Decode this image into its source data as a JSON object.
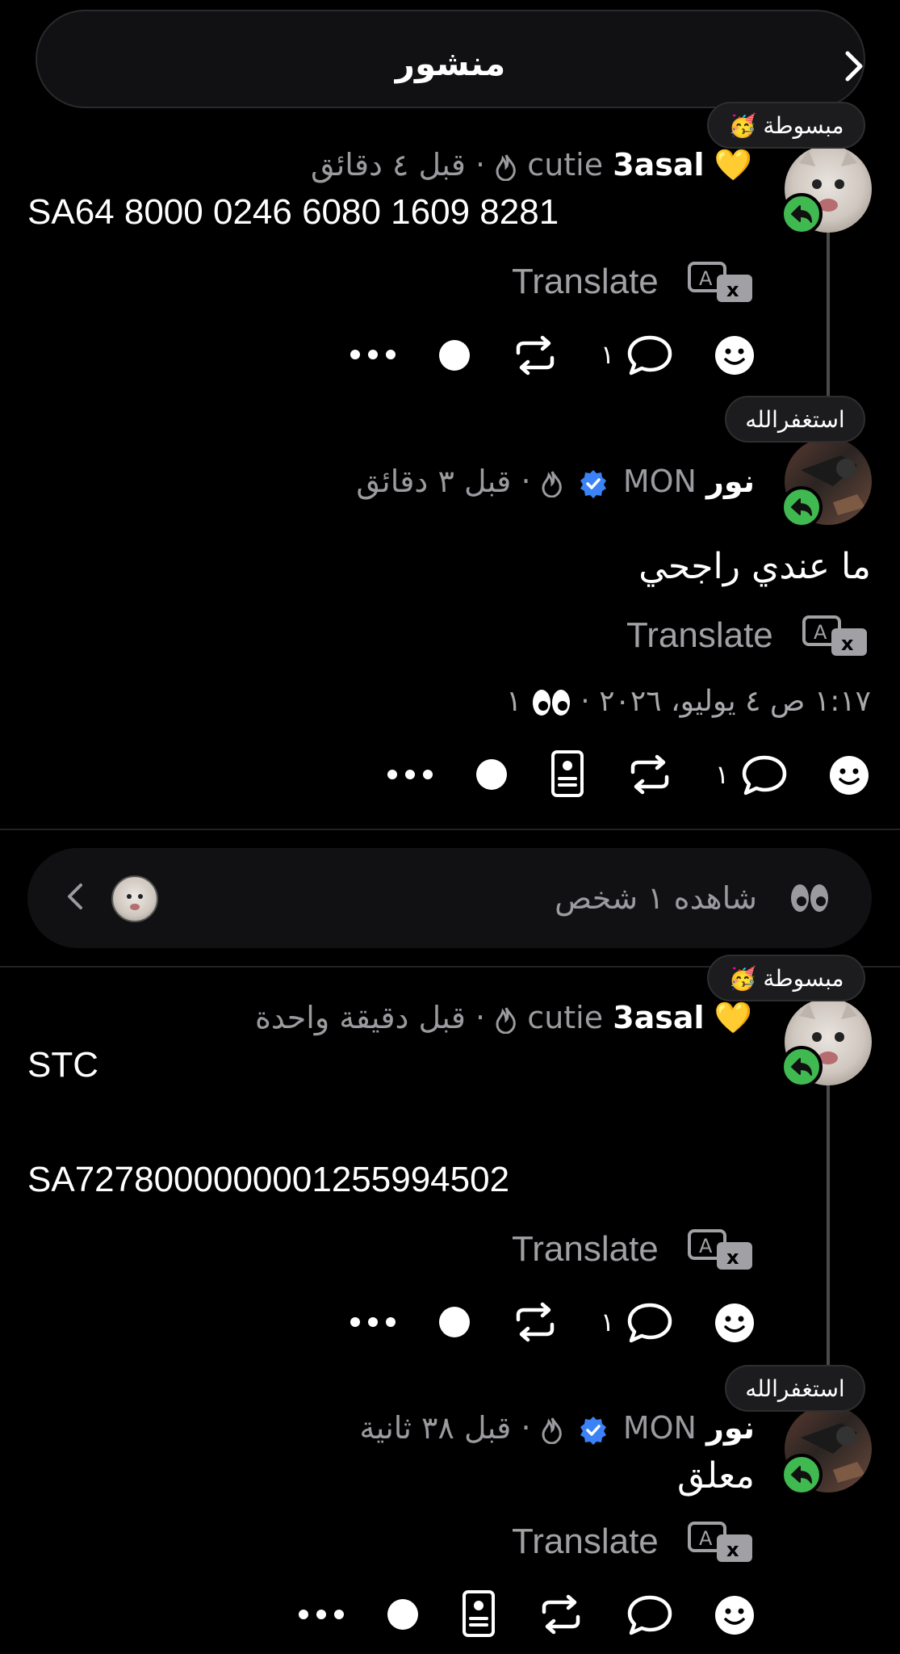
{
  "header": {
    "title": "منشور",
    "back_icon": "chevron-right-icon"
  },
  "posts": [
    {
      "mood": "مبسوطة",
      "mood_emoji": "🥳",
      "username": "3asal",
      "handle_suffix": "cutie",
      "time": "قبل ٤ دقائق",
      "text": "SA64 8000 0246 6080 1609 8281",
      "translate": "Translate",
      "reply_count": "١"
    },
    {
      "mood": "استغفرالله",
      "username": "نور",
      "handle_suffix": "MON",
      "time": "قبل ٣ دقائق",
      "text": "ما عندي راجحي",
      "translate": "Translate",
      "date": "١:١٧ ص ٤ يوليو، ٢٠٢٦",
      "views": "١",
      "reply_count": "١"
    },
    {
      "mood": "مبسوطة",
      "mood_emoji": "🥳",
      "username": "3asal",
      "handle_suffix": "cutie",
      "time": "قبل دقيقة واحدة",
      "text_line1": "STC",
      "text_line2": "SA7278000000001255994502",
      "translate": "Translate",
      "reply_count": "١"
    },
    {
      "mood": "استغفرالله",
      "username": "نور",
      "handle_suffix": "MON",
      "time": "قبل ٣٨ ثانية",
      "text": "معلق",
      "translate": "Translate"
    }
  ],
  "seen_bar": {
    "text": "شاهده ١ شخص"
  },
  "colors": {
    "background": "#000000",
    "reply_badge": "#3fb950",
    "verified": "#3b82f6",
    "muted": "#9a9a9f"
  }
}
